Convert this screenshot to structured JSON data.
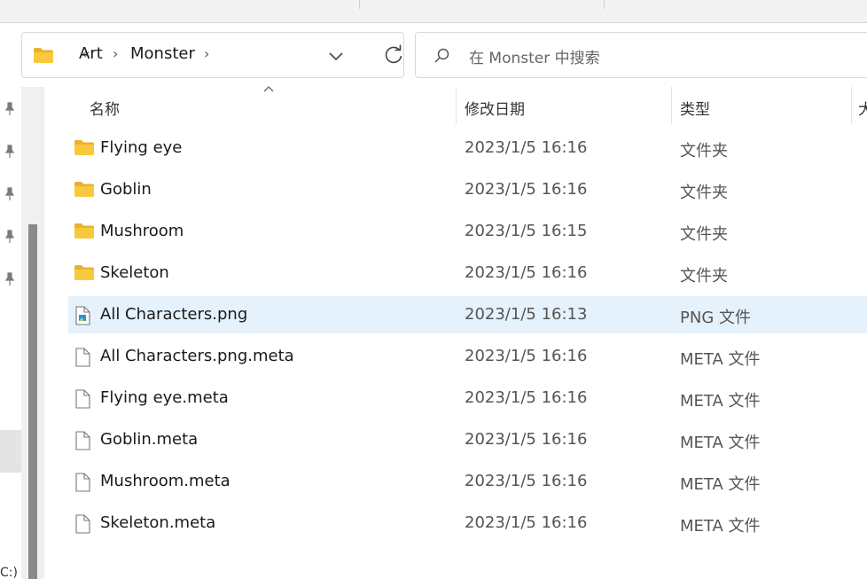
{
  "breadcrumb": {
    "overflow": "«",
    "items": [
      "Art",
      "Monster"
    ]
  },
  "search": {
    "placeholder": "在 Monster 中搜索"
  },
  "columns": {
    "name": "名称",
    "modified": "修改日期",
    "type": "类型",
    "size": "大"
  },
  "nav": {
    "drive_label": "C:)"
  },
  "files": [
    {
      "name": "Flying eye",
      "date": "2023/1/5 16:16",
      "type": "文件夹",
      "icon": "folder-icon",
      "selected": false
    },
    {
      "name": "Goblin",
      "date": "2023/1/5 16:16",
      "type": "文件夹",
      "icon": "folder-icon",
      "selected": false
    },
    {
      "name": "Mushroom",
      "date": "2023/1/5 16:15",
      "type": "文件夹",
      "icon": "folder-icon",
      "selected": false
    },
    {
      "name": "Skeleton",
      "date": "2023/1/5 16:16",
      "type": "文件夹",
      "icon": "folder-icon",
      "selected": false
    },
    {
      "name": "All Characters.png",
      "date": "2023/1/5 16:13",
      "type": "PNG 文件",
      "icon": "image-file-icon",
      "selected": true
    },
    {
      "name": "All Characters.png.meta",
      "date": "2023/1/5 16:16",
      "type": "META 文件",
      "icon": "file-icon",
      "selected": false
    },
    {
      "name": "Flying eye.meta",
      "date": "2023/1/5 16:16",
      "type": "META 文件",
      "icon": "file-icon",
      "selected": false
    },
    {
      "name": "Goblin.meta",
      "date": "2023/1/5 16:16",
      "type": "META 文件",
      "icon": "file-icon",
      "selected": false
    },
    {
      "name": "Mushroom.meta",
      "date": "2023/1/5 16:16",
      "type": "META 文件",
      "icon": "file-icon",
      "selected": false
    },
    {
      "name": "Skeleton.meta",
      "date": "2023/1/5 16:16",
      "type": "META 文件",
      "icon": "file-icon",
      "selected": false
    }
  ],
  "colors": {
    "selection": "#e5f1fb",
    "folder": "#f8c93c",
    "accent": "#0067c0"
  }
}
